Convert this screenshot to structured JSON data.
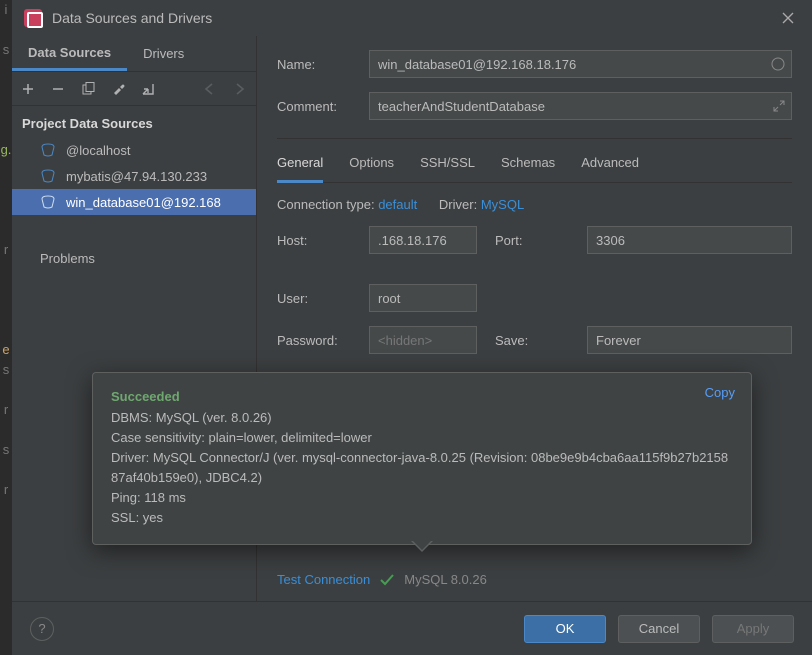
{
  "window": {
    "title": "Data Sources and Drivers"
  },
  "left_gutter": [
    "i",
    "",
    "s",
    "",
    "",
    "",
    "",
    "g.",
    "",
    "",
    "",
    "",
    "r",
    "",
    "",
    "",
    "",
    "e",
    "s",
    "",
    "r",
    "",
    "s",
    "",
    "r"
  ],
  "sidebar": {
    "tabs": [
      {
        "label": "Data Sources",
        "active": true
      },
      {
        "label": "Drivers",
        "active": false
      }
    ],
    "section_title": "Project Data Sources",
    "items": [
      {
        "label": "@localhost",
        "selected": false
      },
      {
        "label": "mybatis@47.94.130.233",
        "selected": false
      },
      {
        "label": "win_database01@192.168",
        "selected": true
      }
    ],
    "problems_label": "Problems"
  },
  "form": {
    "name_label": "Name:",
    "name_value": "win_database01@192.168.18.176",
    "comment_label": "Comment:",
    "comment_value": "teacherAndStudentDatabase",
    "subtabs": [
      {
        "label": "General",
        "active": true
      },
      {
        "label": "Options",
        "active": false
      },
      {
        "label": "SSH/SSL",
        "active": false
      },
      {
        "label": "Schemas",
        "active": false
      },
      {
        "label": "Advanced",
        "active": false
      }
    ],
    "connection_type_label": "Connection type:",
    "connection_type_value": "default",
    "driver_label": "Driver:",
    "driver_value": "MySQL",
    "host_label": "Host:",
    "host_value": ".168.18.176",
    "port_label": "Port:",
    "port_value": "3306",
    "user_label": "User:",
    "user_value": "root",
    "password_label": "Password:",
    "password_placeholder": "<hidden>",
    "save_label": "Save:",
    "save_value": "Forever",
    "test_connection_label": "Test Connection",
    "driver_version_text": "MySQL 8.0.26"
  },
  "popup": {
    "status": "Succeeded",
    "copy_label": "Copy",
    "lines": [
      "DBMS: MySQL (ver. 8.0.26)",
      "Case sensitivity: plain=lower, delimited=lower",
      "Driver: MySQL Connector/J (ver. mysql-connector-java-8.0.25 (Revision: 08be9e9b4cba6aa115f9b27b215887af40b159e0), JDBC4.2)",
      "Ping: 118 ms",
      "SSL: yes"
    ]
  },
  "footer": {
    "ok": "OK",
    "cancel": "Cancel",
    "apply": "Apply"
  }
}
